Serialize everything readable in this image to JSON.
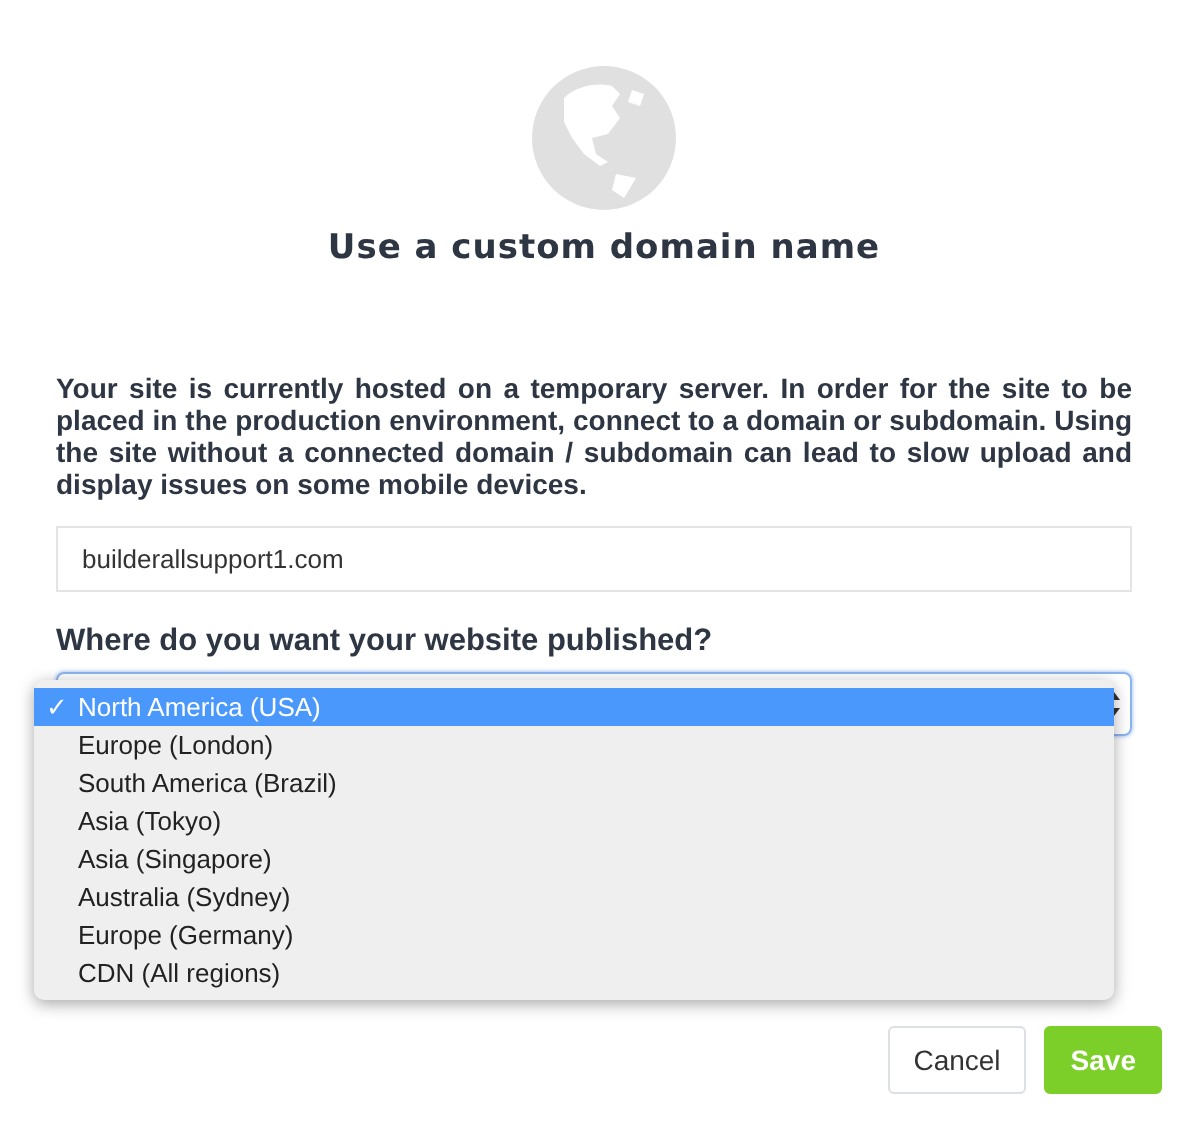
{
  "title": "Use a custom domain name",
  "description": "Your site is currently hosted on a temporary server. In order for the site to be placed in the production environment, connect to a domain or subdomain. Using the site without a connected domain / subdomain can lead to slow upload and display issues on some mobile devices.",
  "domain_field": {
    "value": "builderallsupport1.com"
  },
  "region": {
    "label": "Where do you want your website published?",
    "expanded": true,
    "check_glyph": "✓",
    "options": [
      {
        "label": "North America (USA)",
        "selected": true
      },
      {
        "label": "Europe (London)",
        "selected": false
      },
      {
        "label": "South America (Brazil)",
        "selected": false
      },
      {
        "label": "Asia (Tokyo)",
        "selected": false
      },
      {
        "label": "Asia (Singapore)",
        "selected": false
      },
      {
        "label": "Australia (Sydney)",
        "selected": false
      },
      {
        "label": "Europe (Germany)",
        "selected": false
      },
      {
        "label": "CDN (All regions)",
        "selected": false
      }
    ]
  },
  "buttons": [
    {
      "label": "Cancel",
      "kind": "secondary"
    },
    {
      "label": "Save",
      "kind": "primary"
    }
  ]
}
